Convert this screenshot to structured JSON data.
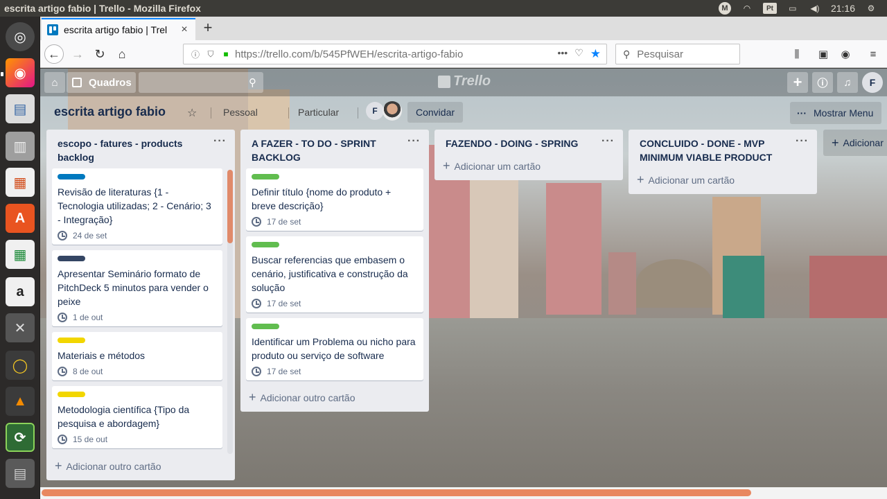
{
  "system": {
    "window_title": "escrita artigo fabio | Trello - Mozilla Firefox",
    "clock": "21:16",
    "tray_m": "M",
    "tray_keyboard": "Pt"
  },
  "browser": {
    "tab_title": "escrita artigo fabio | Trel",
    "url_host": "https://trello.com",
    "url_path": "/b/545PfWEH/escrita-artigo-fabio",
    "search_placeholder": "Pesquisar"
  },
  "trello": {
    "header": {
      "boards_label": "Quadros",
      "logo": "Trello",
      "avatar": "F"
    },
    "board": {
      "name": "escrita artigo fabio",
      "team": "Pessoal",
      "visibility": "Particular",
      "member_initial": "F",
      "invite_label": "Convidar",
      "menu_label": "Mostrar Menu"
    },
    "lists": [
      {
        "title": "escopo - fatures - products backlog",
        "add_label": "Adicionar outro cartão",
        "cards": [
          {
            "label_color": "#0079bf",
            "title": "Revisão de literaturas {1 - Tecnologia utilizadas; 2 - Cenário; 3 - Integração}",
            "due": "24 de set"
          },
          {
            "label_color": "#344563",
            "title": "Apresentar Seminário formato de PitchDeck 5 minutos para vender o peixe",
            "due": "1 de out"
          },
          {
            "label_color": "#f2d600",
            "title": "Materiais e métodos",
            "due": "8 de out"
          },
          {
            "label_color": "#f2d600",
            "title": "Metodologia científica {Tipo da pesquisa e abordagem}",
            "due": "15 de out"
          }
        ]
      },
      {
        "title": "A FAZER - TO  DO - SPRINT BACKLOG",
        "add_label": "Adicionar outro cartão",
        "cards": [
          {
            "label_color": "#61bd4f",
            "title": "Definir título {nome do produto + breve descrição}",
            "due": "17 de set"
          },
          {
            "label_color": "#61bd4f",
            "title": "Buscar referencias que embasem o cenário, justificativa e construção da solução",
            "due": "17 de set"
          },
          {
            "label_color": "#61bd4f",
            "title": "Identificar um Problema ou nicho para produto ou serviço de software",
            "due": "17 de set"
          }
        ]
      },
      {
        "title": "FAZENDO - DOING  - SPRING",
        "add_label": "Adicionar um cartão",
        "cards": []
      },
      {
        "title": "CONCLUIDO - DONE  - MVP MINIMUM VIABLE PRODUCT",
        "add_label": "Adicionar um cartão",
        "cards": []
      }
    ],
    "add_list_label": "Adicionar"
  }
}
